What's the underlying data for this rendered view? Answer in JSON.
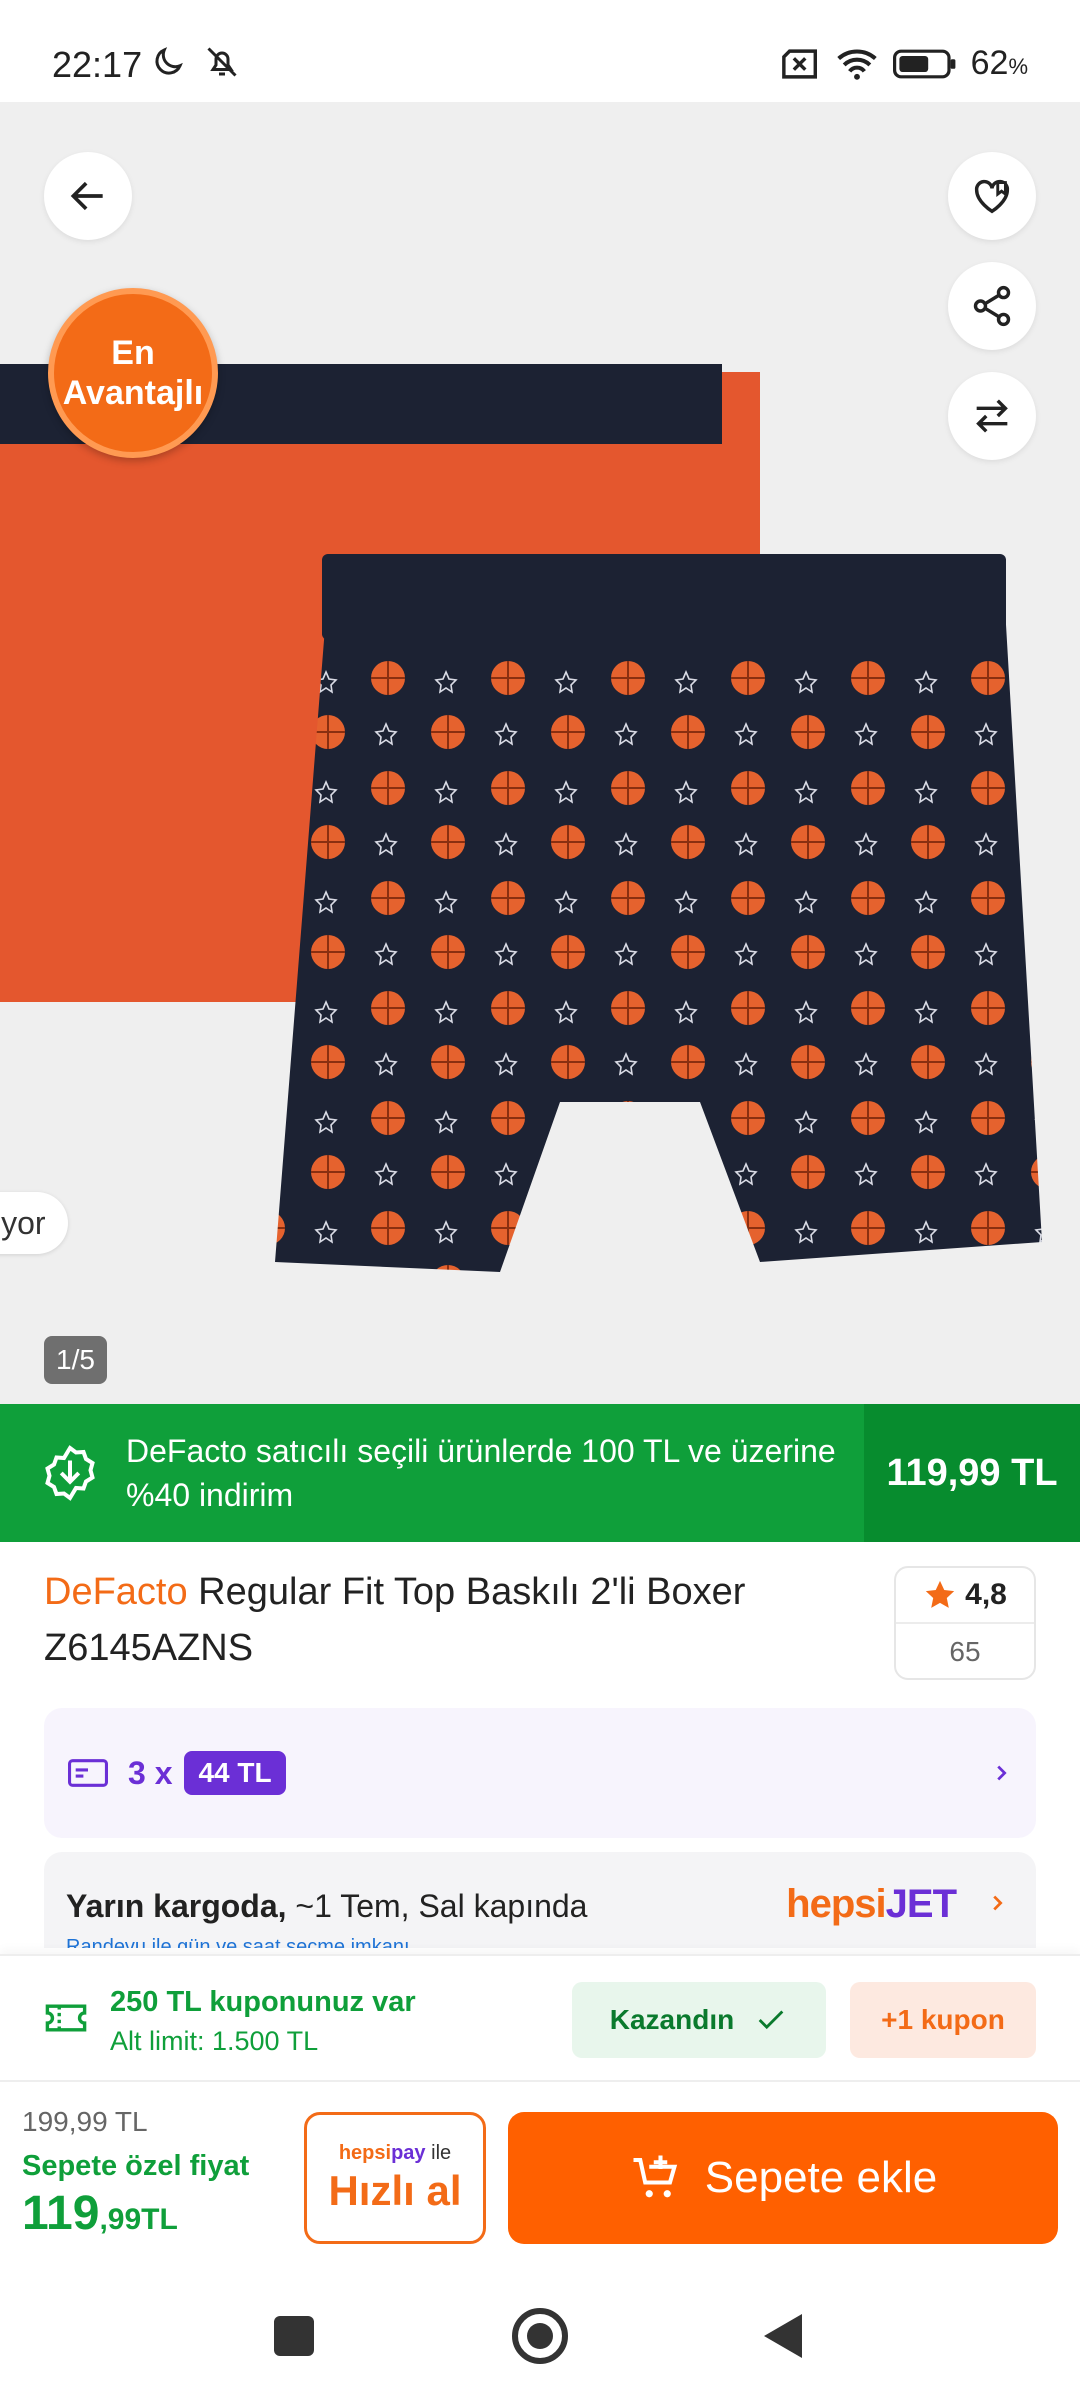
{
  "status_bar": {
    "time": "22:17",
    "battery": "62",
    "battery_unit": "%",
    "icons": [
      "moon-icon",
      "bell-off-icon",
      "no-sim-icon",
      "wifi-icon",
      "battery-icon"
    ]
  },
  "gallery": {
    "badge_line1": "En",
    "badge_line2": "Avantajlı",
    "tag_text": "iyor",
    "page_indicator": "1/5",
    "colors": {
      "background": "#efefef",
      "orange_boxer": "#e4572e",
      "navy_boxer": "#1c2233"
    }
  },
  "promo": {
    "text": "DeFacto satıcılı seçili ürünlerde 100 TL ve üzerine %40 indirim",
    "price": "119,99 TL",
    "colors": {
      "bg": "#0f9f3a",
      "price_bg": "#078c2e"
    }
  },
  "product": {
    "brand": "DeFacto",
    "title": " Regular Fit Top Baskılı 2'li Boxer Z6145AZNS",
    "rating": "4,8",
    "rating_count": "65"
  },
  "installment": {
    "prefix": "3 x",
    "amount": "44 TL"
  },
  "shipping": {
    "main_bold": "Yarın kargoda,",
    "main_rest": " ~1 Tem, Sal kapında",
    "sub": "Randevu ile gün ve saat seçme imkanı",
    "logo_hepsi": "hepsi",
    "logo_jet": "JET"
  },
  "coupon": {
    "title": "250 TL kuponunuz var",
    "limit": "Alt limit: 1.500 TL",
    "won_label": "Kazandın",
    "more_label": "+1 kupon"
  },
  "buy_bar": {
    "old_price": "199,99 TL",
    "special_label": "Sepete özel fiyat",
    "price_main": "119",
    "price_cents": ",99TL",
    "quick_brand_1": "hepsi",
    "quick_brand_2": "pay",
    "quick_brand_suffix": " ile",
    "quick_label": "Hızlı al",
    "cart_label": "Sepete ekle",
    "colors": {
      "accent": "#ff6000",
      "green": "#0f9f3a"
    }
  }
}
